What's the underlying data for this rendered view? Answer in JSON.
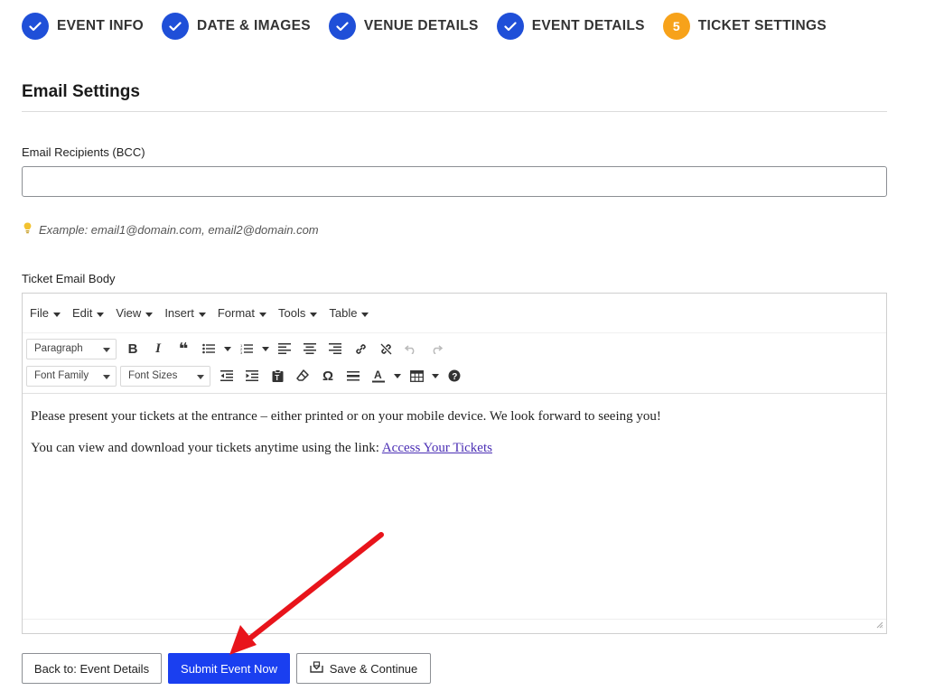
{
  "stepper": {
    "steps": [
      {
        "label": "EVENT INFO",
        "state": "done"
      },
      {
        "label": "DATE & IMAGES",
        "state": "done"
      },
      {
        "label": "VENUE DETAILS",
        "state": "done"
      },
      {
        "label": "EVENT DETAILS",
        "state": "done"
      },
      {
        "label": "TICKET SETTINGS",
        "state": "current",
        "number": "5"
      }
    ]
  },
  "section": {
    "title": "Email Settings"
  },
  "bcc": {
    "label": "Email Recipients (BCC)",
    "value": "",
    "placeholder": ""
  },
  "hint": {
    "text": "Example: email1@domain.com, email2@domain.com",
    "icon": "lightbulb-icon"
  },
  "editor": {
    "label": "Ticket Email Body",
    "menu": [
      "File",
      "Edit",
      "View",
      "Insert",
      "Format",
      "Tools",
      "Table"
    ],
    "paragraph_select": "Paragraph",
    "font_family_select": "Font Family",
    "font_size_select": "Font Sizes",
    "content": {
      "p1": "Please present your tickets at the entrance – either printed or on your mobile device. We look forward to seeing you!",
      "p2": "You can view and download your tickets anytime using the link: ",
      "link": "Access Your Tickets"
    }
  },
  "buttons": {
    "back": "Back to: Event Details",
    "submit": "Submit Event Now",
    "save": "Save & Continue"
  },
  "colors": {
    "step_done": "#1f4fd8",
    "step_current": "#f7a21a",
    "submit_button": "#1a3ff0",
    "annotation_arrow": "#e8141b"
  }
}
